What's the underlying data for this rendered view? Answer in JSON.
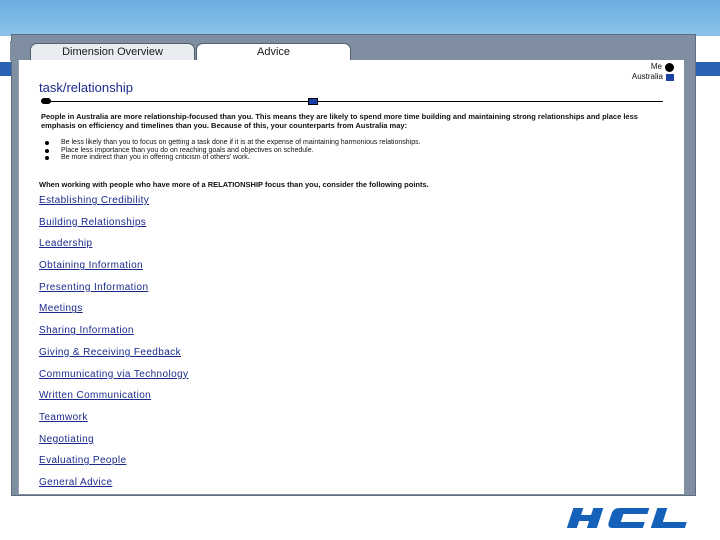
{
  "tabs": [
    {
      "label": "Dimension Overview",
      "active": false
    },
    {
      "label": "Advice",
      "active": true
    }
  ],
  "legend": {
    "me_label": "Me",
    "country_label": "Australia"
  },
  "section": {
    "title": "task/relationship"
  },
  "scale": {
    "me_position": 0.0,
    "country_position": 0.43
  },
  "intro": "People in Australia are more relationship-focused than you. This means they are likely to spend more time building and maintaining strong relationships and place less emphasis on efficiency and timelines than you. Because of this, your counterparts from Australia may:",
  "bullets": [
    "Be less likely than you to focus on getting a task done if it is at the expense of maintaining harmonious relationships.",
    "Place less importance than you do on reaching goals and objectives on schedule.",
    "Be more indirect than you in offering criticism of others' work."
  ],
  "working_text": "When working with people who have more of a RELATIONSHIP focus than you, consider the following points.",
  "links": [
    "Establishing Credibility",
    "Building Relationships",
    "Leadership",
    "Obtaining Information",
    "Presenting Information",
    "Meetings",
    "Sharing Information",
    "Giving & Receiving Feedback",
    "Communicating via Technology",
    "Written Communication",
    "Teamwork",
    "Negotiating",
    "Evaluating People",
    "General Advice"
  ],
  "logo": {
    "text": "HCL",
    "color": "#1560b8"
  },
  "colors": {
    "heading": "#1a2a8c",
    "country_marker": "#1d3fa8",
    "frame": "#7f8ea0",
    "top_band": "#7ab8e6"
  }
}
